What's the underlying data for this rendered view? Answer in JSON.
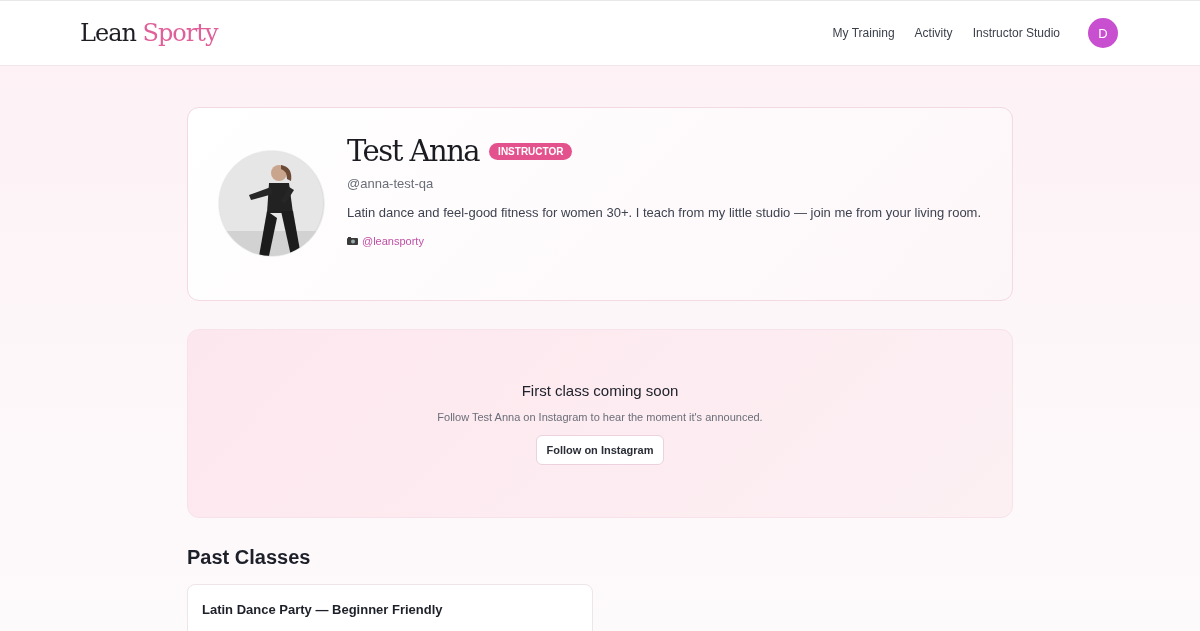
{
  "header": {
    "logo": {
      "first": "Lean",
      "second": "Sporty"
    },
    "nav": [
      {
        "label": "My Training"
      },
      {
        "label": "Activity"
      },
      {
        "label": "Instructor Studio"
      }
    ],
    "user_avatar": "D"
  },
  "profile": {
    "name": "Test Anna",
    "badge": "INSTRUCTOR",
    "handle": "@anna-test-qa",
    "bio": "Latin dance and feel-good fitness for women 30+. I teach from my little studio — join me from your living room.",
    "social": "@leansporty"
  },
  "coming_soon": {
    "title": "First class coming soon",
    "text": "Follow Test Anna on Instagram to hear the moment it's announced.",
    "button": "Follow on Instagram"
  },
  "past_classes": {
    "heading": "Past Classes",
    "items": [
      {
        "title": "Latin Dance Party — Beginner Friendly"
      }
    ]
  }
}
